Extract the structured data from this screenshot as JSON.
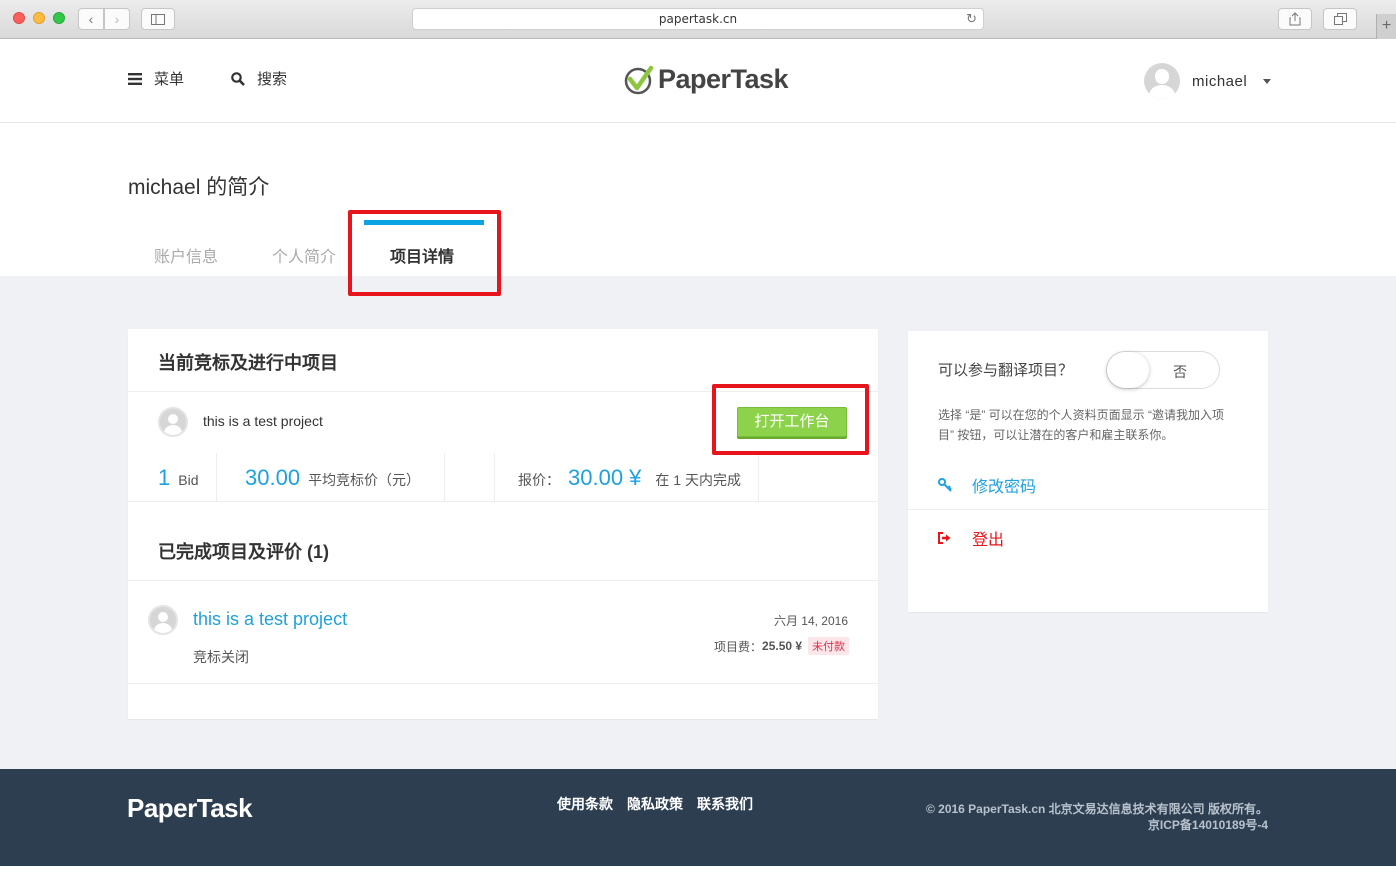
{
  "browser": {
    "url": "papertask.cn"
  },
  "header": {
    "menu_label": "菜单",
    "search_label": "搜索",
    "logo_text": "PaperTask",
    "user_name": "michael"
  },
  "profile": {
    "title": "michael 的简介",
    "tabs": [
      {
        "label": "账户信息",
        "active": false
      },
      {
        "label": "个人简介",
        "active": false
      },
      {
        "label": "项目详情",
        "active": true
      }
    ]
  },
  "current": {
    "title": "当前竞标及进行中项目",
    "project_name": "this is a test project",
    "open_button": "打开工作台",
    "bid_count": "1",
    "bid_unit": "Bid",
    "avg_bid_value": "30.00",
    "avg_bid_label": "平均竞标价（元）",
    "quote_label": "报价：",
    "quote_value": "30.00 ¥",
    "deadline": "在 1 天内完成"
  },
  "completed": {
    "title": "已完成项目及评价 (1)",
    "items": [
      {
        "name": "this is a test project",
        "status": "竞标关闭",
        "date": "六月 14, 2016",
        "fee_label": "项目费：",
        "fee_value": "25.50 ¥",
        "payment_badge": "未付款"
      }
    ]
  },
  "side": {
    "question": "可以参与翻译项目？",
    "toggle_value": "否",
    "note": "选择 “是” 可以在您的个人资料页面显示 “邀请我加入项目” 按钮，可以让潜在的客户和雇主联系你。",
    "change_password": "修改密码",
    "logout": "登出"
  },
  "footer": {
    "logo_text": "PaperTask",
    "links": [
      "使用条款",
      "隐私政策",
      "联系我们"
    ],
    "copyright": "© 2016 PaperTask.cn 北京文易达信息技术有限公司 版权所有。",
    "icp": "京ICP备14010189号-4"
  },
  "colors": {
    "accent_blue": "#1ea1e0",
    "tab_indicator": "#0aa3e3",
    "button_green": "#8cd24a",
    "logout_red": "#e8141b",
    "footer_bg": "#2c3e50",
    "annotation_red": "#e8141b"
  }
}
